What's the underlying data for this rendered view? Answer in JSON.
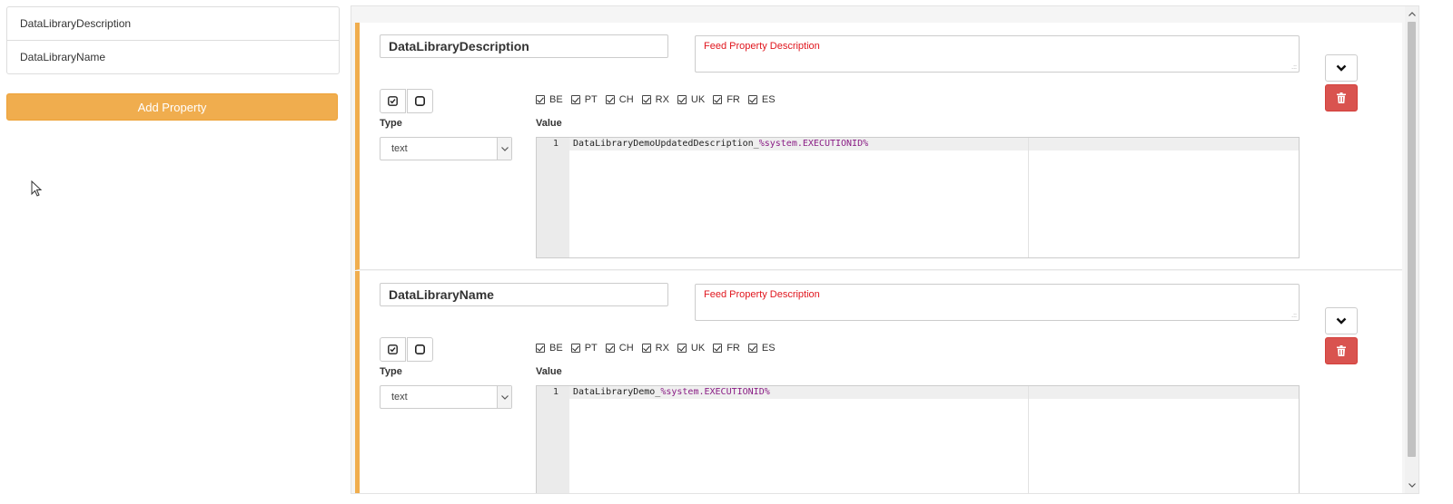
{
  "sidebar": {
    "properties": [
      "DataLibraryDescription",
      "DataLibraryName"
    ],
    "add_button_label": "Add Property"
  },
  "editor_panel": {
    "properties": [
      {
        "name": "DataLibraryDescription",
        "description_placeholder": "Feed Property Description",
        "countries": [
          "BE",
          "PT",
          "CH",
          "RX",
          "UK",
          "FR",
          "ES"
        ],
        "type_label": "Type",
        "type_value": "text",
        "value_label": "Value",
        "line_number": "1",
        "value_plain": "DataLibraryDemoUpdatedDescription_",
        "value_variable": "%system.EXECUTIONID%"
      },
      {
        "name": "DataLibraryName",
        "description_placeholder": "Feed Property Description",
        "countries": [
          "BE",
          "PT",
          "CH",
          "RX",
          "UK",
          "FR",
          "ES"
        ],
        "type_label": "Type",
        "type_value": "text",
        "value_label": "Value",
        "line_number": "1",
        "value_plain": "DataLibraryDemo_",
        "value_variable": "%system.EXECUTIONID%"
      }
    ]
  },
  "colors": {
    "accent_orange": "#f0ad4e",
    "danger_red": "#d9534f",
    "placeholder_red": "#e0161e",
    "code_variable": "#8a1d85"
  },
  "icons": {
    "select_all": "check-square-icon",
    "select_none": "square-icon",
    "collapse": "chevron-down-icon",
    "delete": "trash-icon",
    "cursor": "mouse-pointer-icon"
  }
}
